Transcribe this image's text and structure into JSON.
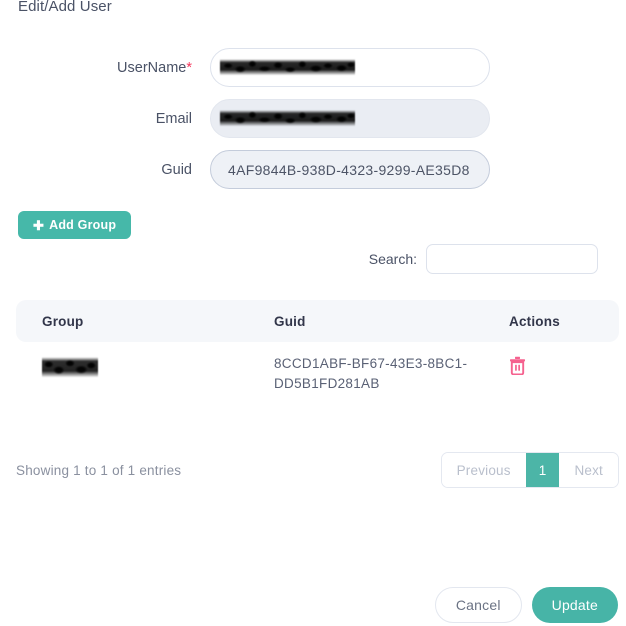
{
  "page": {
    "title": "Edit/Add User"
  },
  "form": {
    "fields": [
      {
        "label": "UserName",
        "required_marker": "*",
        "value": "",
        "placeholder": "",
        "state": "editable",
        "redacted": true
      },
      {
        "label": "Email",
        "required_marker": "",
        "value": "",
        "placeholder": "",
        "state": "readonly",
        "redacted": true
      },
      {
        "label": "Guid",
        "required_marker": "",
        "value": "4AF9844B-938D-4323-9299-AE35D8",
        "placeholder": "",
        "state": "readonly",
        "redacted": false
      }
    ]
  },
  "toolbar": {
    "add_group_label": "Add Group",
    "add_group_icon": "plus-icon",
    "add_group_color": "#46b8a9"
  },
  "search": {
    "label": "Search:",
    "value": "",
    "placeholder": ""
  },
  "table": {
    "columns": [
      "Group",
      "Guid",
      "Actions"
    ],
    "rows": [
      {
        "group": "",
        "group_redacted": true,
        "guid": "8CCD1ABF-BF67-43E3-8BC1-DD5B1FD281AB",
        "action_icon": "trash-icon",
        "action_color": "#f5628f"
      }
    ]
  },
  "footer": {
    "entries_info": "Showing 1 to 1 of 1 entries",
    "pagination": {
      "previous_label": "Previous",
      "next_label": "Next",
      "pages": [
        "1"
      ],
      "active_page": "1",
      "active_color": "#4cb5a7"
    }
  },
  "actions": {
    "cancel_label": "Cancel",
    "update_label": "Update",
    "update_color": "#47b4a7"
  }
}
